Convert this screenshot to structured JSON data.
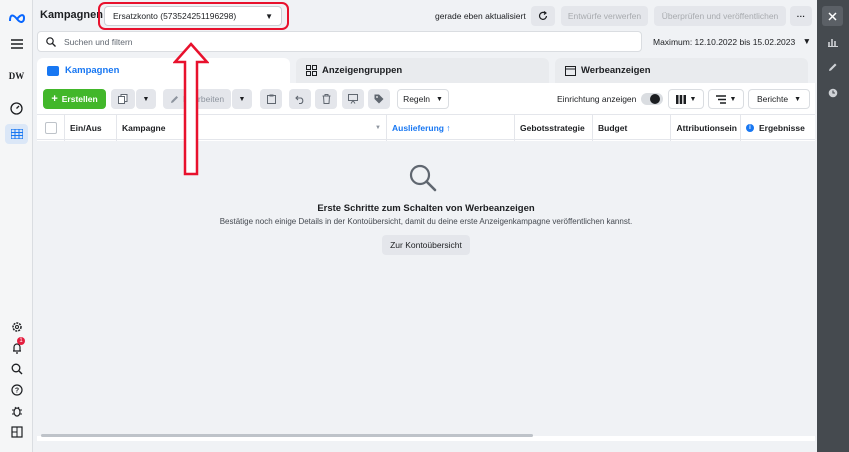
{
  "header": {
    "title": "Kampagnen",
    "account": "Ersatzkonto (573524251196298)",
    "updated": "gerade eben aktualisiert",
    "discard_label": "Entwürfe verwerfen",
    "publish_label": "Überprüfen und veröffentlichen",
    "more_label": "···"
  },
  "search": {
    "placeholder": "Suchen und filtern",
    "date_range": "Maximum: 12.10.2022 bis 15.02.2023"
  },
  "leftnav": {
    "brand": "DW",
    "notification_count": "1"
  },
  "tabs": [
    {
      "label": "Kampagnen",
      "icon": "campaign-icon"
    },
    {
      "label": "Anzeigengruppen",
      "icon": "grid-icon"
    },
    {
      "label": "Werbeanzeigen",
      "icon": "ad-icon"
    }
  ],
  "toolbar": {
    "create_label": "Erstellen",
    "edit_label": "Bearbeiten",
    "rules_label": "Regeln",
    "setup_label": "Einrichtung anzeigen",
    "reports_label": "Berichte"
  },
  "table": {
    "columns": [
      "Ein/Aus",
      "Kampagne",
      "Auslieferung ↑",
      "Gebotsstrategie",
      "Budget",
      "Attributionsein",
      "Ergebnisse"
    ]
  },
  "empty_state": {
    "title": "Erste Schritte zum Schalten von Werbeanzeigen",
    "subtitle": "Bestätige noch einige Details in der Kontoübersicht, damit du deine erste Anzeigenkampagne veröffentlichen kannst.",
    "button_label": "Zur Kontoübersicht"
  },
  "colors": {
    "accent": "#1877f2",
    "create": "#42b72a",
    "highlight": "#e8112d"
  }
}
